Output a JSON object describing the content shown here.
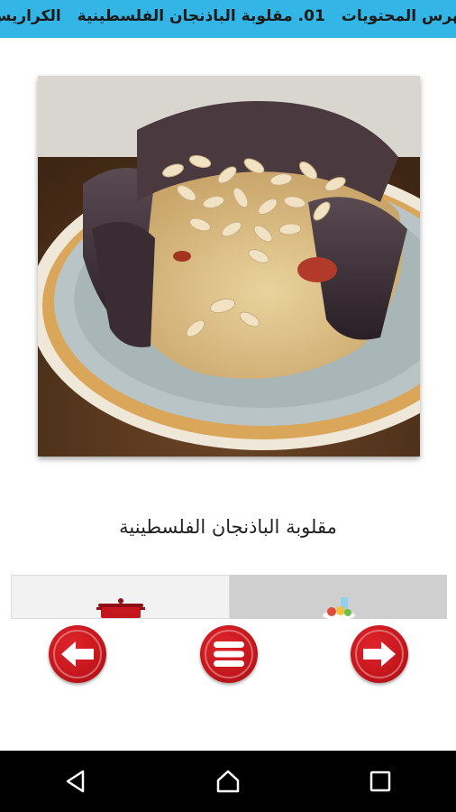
{
  "header": {
    "items": [
      "فهرس المحتويات",
      "01. مقلوبة الباذنجان الفلسطينية",
      "الكراريس اللبنانية"
    ]
  },
  "recipe": {
    "title": "مقلوبة الباذنجان الفلسطينية"
  },
  "tabs": [
    {
      "icon": "cooking-pot-icon",
      "selected": true
    },
    {
      "icon": "ingredients-icon",
      "selected": false
    }
  ],
  "navigation": {
    "prev": "arrow-left-icon",
    "menu": "menu-icon",
    "next": "arrow-right-icon"
  },
  "colors": {
    "header": "#33b5e5",
    "accent_red": "#c4161c",
    "system_bar": "#000000"
  }
}
